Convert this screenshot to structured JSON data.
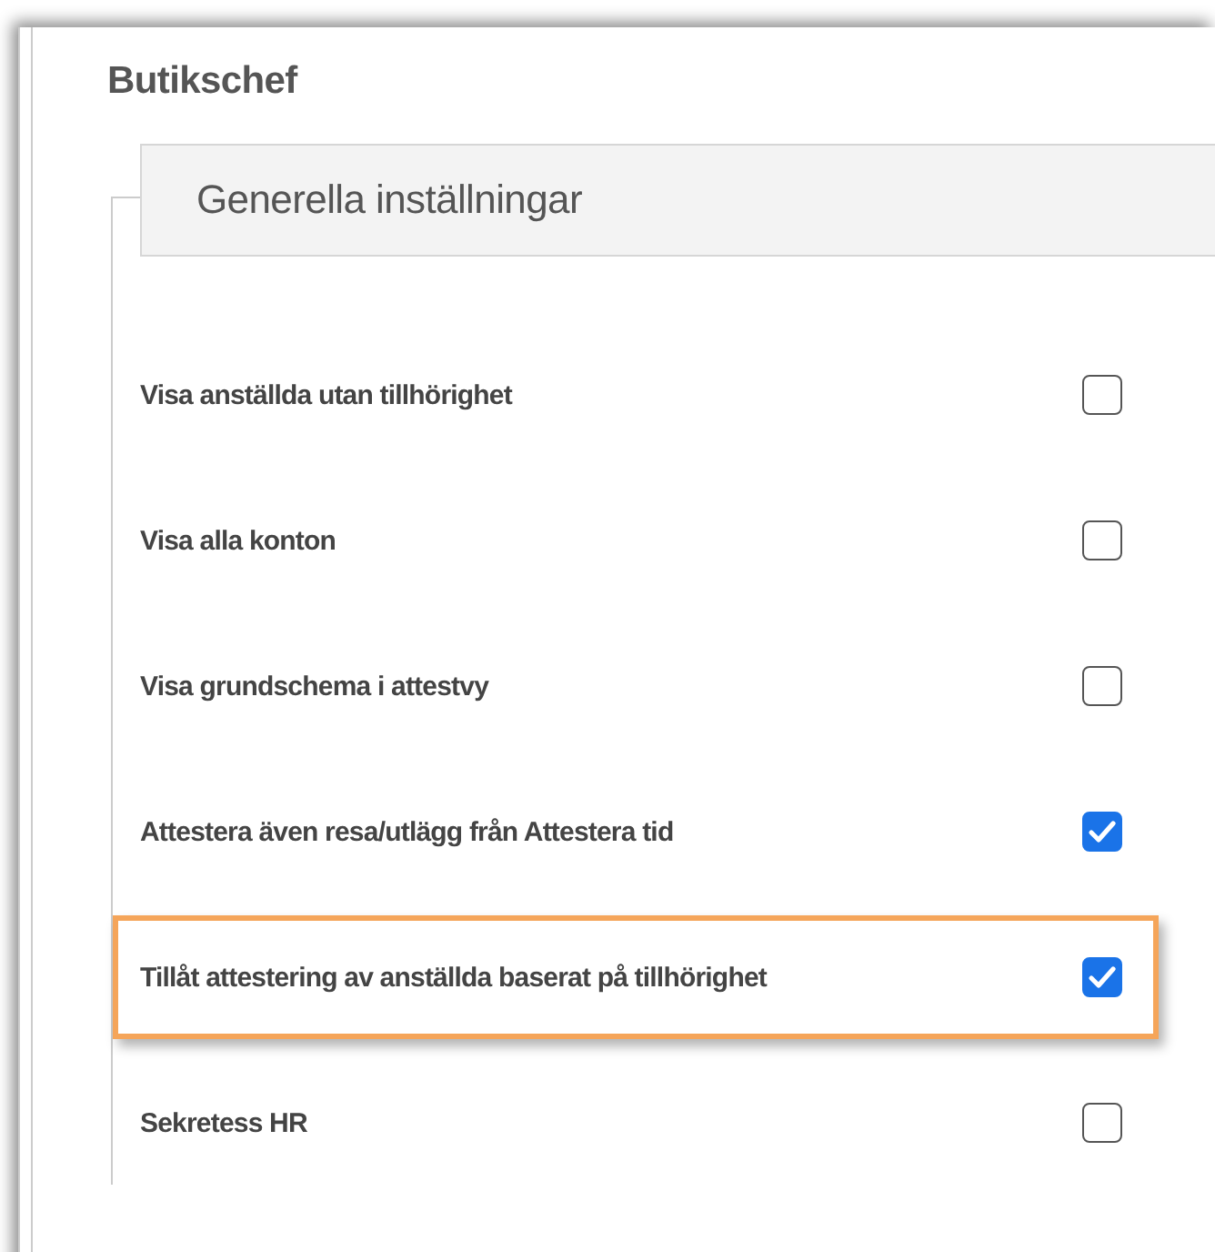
{
  "title": "Butikschef",
  "section": {
    "legend": "Generella inställningar",
    "settings": [
      {
        "label": "Visa anställda utan tillhörighet",
        "checked": false,
        "highlighted": false
      },
      {
        "label": "Visa alla konton",
        "checked": false,
        "highlighted": false
      },
      {
        "label": "Visa grundschema i attestvy",
        "checked": false,
        "highlighted": false
      },
      {
        "label": "Attestera även resa/utlägg från Attestera tid",
        "checked": true,
        "highlighted": false
      },
      {
        "label": "Tillåt attestering av anställda baserat på tillhörighet",
        "checked": true,
        "highlighted": true
      },
      {
        "label": "Sekretess HR",
        "checked": false,
        "highlighted": false
      }
    ]
  }
}
